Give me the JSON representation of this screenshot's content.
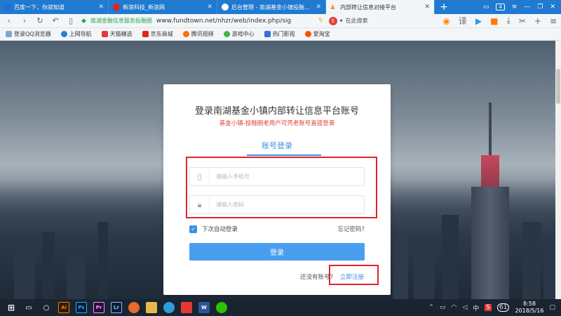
{
  "tabs": [
    {
      "label": "百度一下，你就知道",
      "color": "#2b6bd6"
    },
    {
      "label": "新浪科技_新浪网",
      "color": "#e2231a"
    },
    {
      "label": "后台管理 - 南湖基金小镇投融圈-内部",
      "color": "#ffffff"
    },
    {
      "label": "内部转让信息对接平台",
      "color": "#e8a33a"
    }
  ],
  "tab_count": "4",
  "address": {
    "site_name": "南湖金融信息服务投融圈",
    "url": "www.fundtown.net/nhzr/web/index.php/sig",
    "search_placeholder": "在此搜索"
  },
  "bookmarks": [
    {
      "label": "登录QQ浏览器",
      "color": "#7aa7d8"
    },
    {
      "label": "上网导航",
      "color": "#2b7be0"
    },
    {
      "label": "天猫精选",
      "color": "#e4393c"
    },
    {
      "label": "京东商城",
      "color": "#e1251b"
    },
    {
      "label": "腾讯视频",
      "color": "#ff6d00"
    },
    {
      "label": "游戏中心",
      "color": "#41b34e"
    },
    {
      "label": "热门影视",
      "color": "#3b6fd1"
    },
    {
      "label": "爱淘宝",
      "color": "#ff5000"
    }
  ],
  "login": {
    "title": "登录南湖基金小镇内部转让信息平台账号",
    "subtitle": "基金小镇-投融圈老用户可凭老账号直接登录",
    "tab_label": "账号登录",
    "phone_placeholder": "请输入手机号",
    "password_placeholder": "请输入密码",
    "remember_label": "下次自动登录",
    "forgot_label": "忘记密码?",
    "submit_label": "登录",
    "no_account_label": "还没有账号?",
    "register_label": "立即注册"
  },
  "taskbar": {
    "apps": [
      {
        "label": "Ai",
        "color": "#ff7c00",
        "bg": "#2b1a06"
      },
      {
        "label": "Ps",
        "color": "#31a8ff",
        "bg": "#001e36"
      },
      {
        "label": "Pr",
        "color": "#e6a0ff",
        "bg": "#2a0a36"
      },
      {
        "label": "Lr",
        "color": "#90b8ff",
        "bg": "#0a1e36"
      }
    ],
    "time": "8:58",
    "date": "2018/5/16",
    "ime": "中",
    "badge": "61"
  }
}
